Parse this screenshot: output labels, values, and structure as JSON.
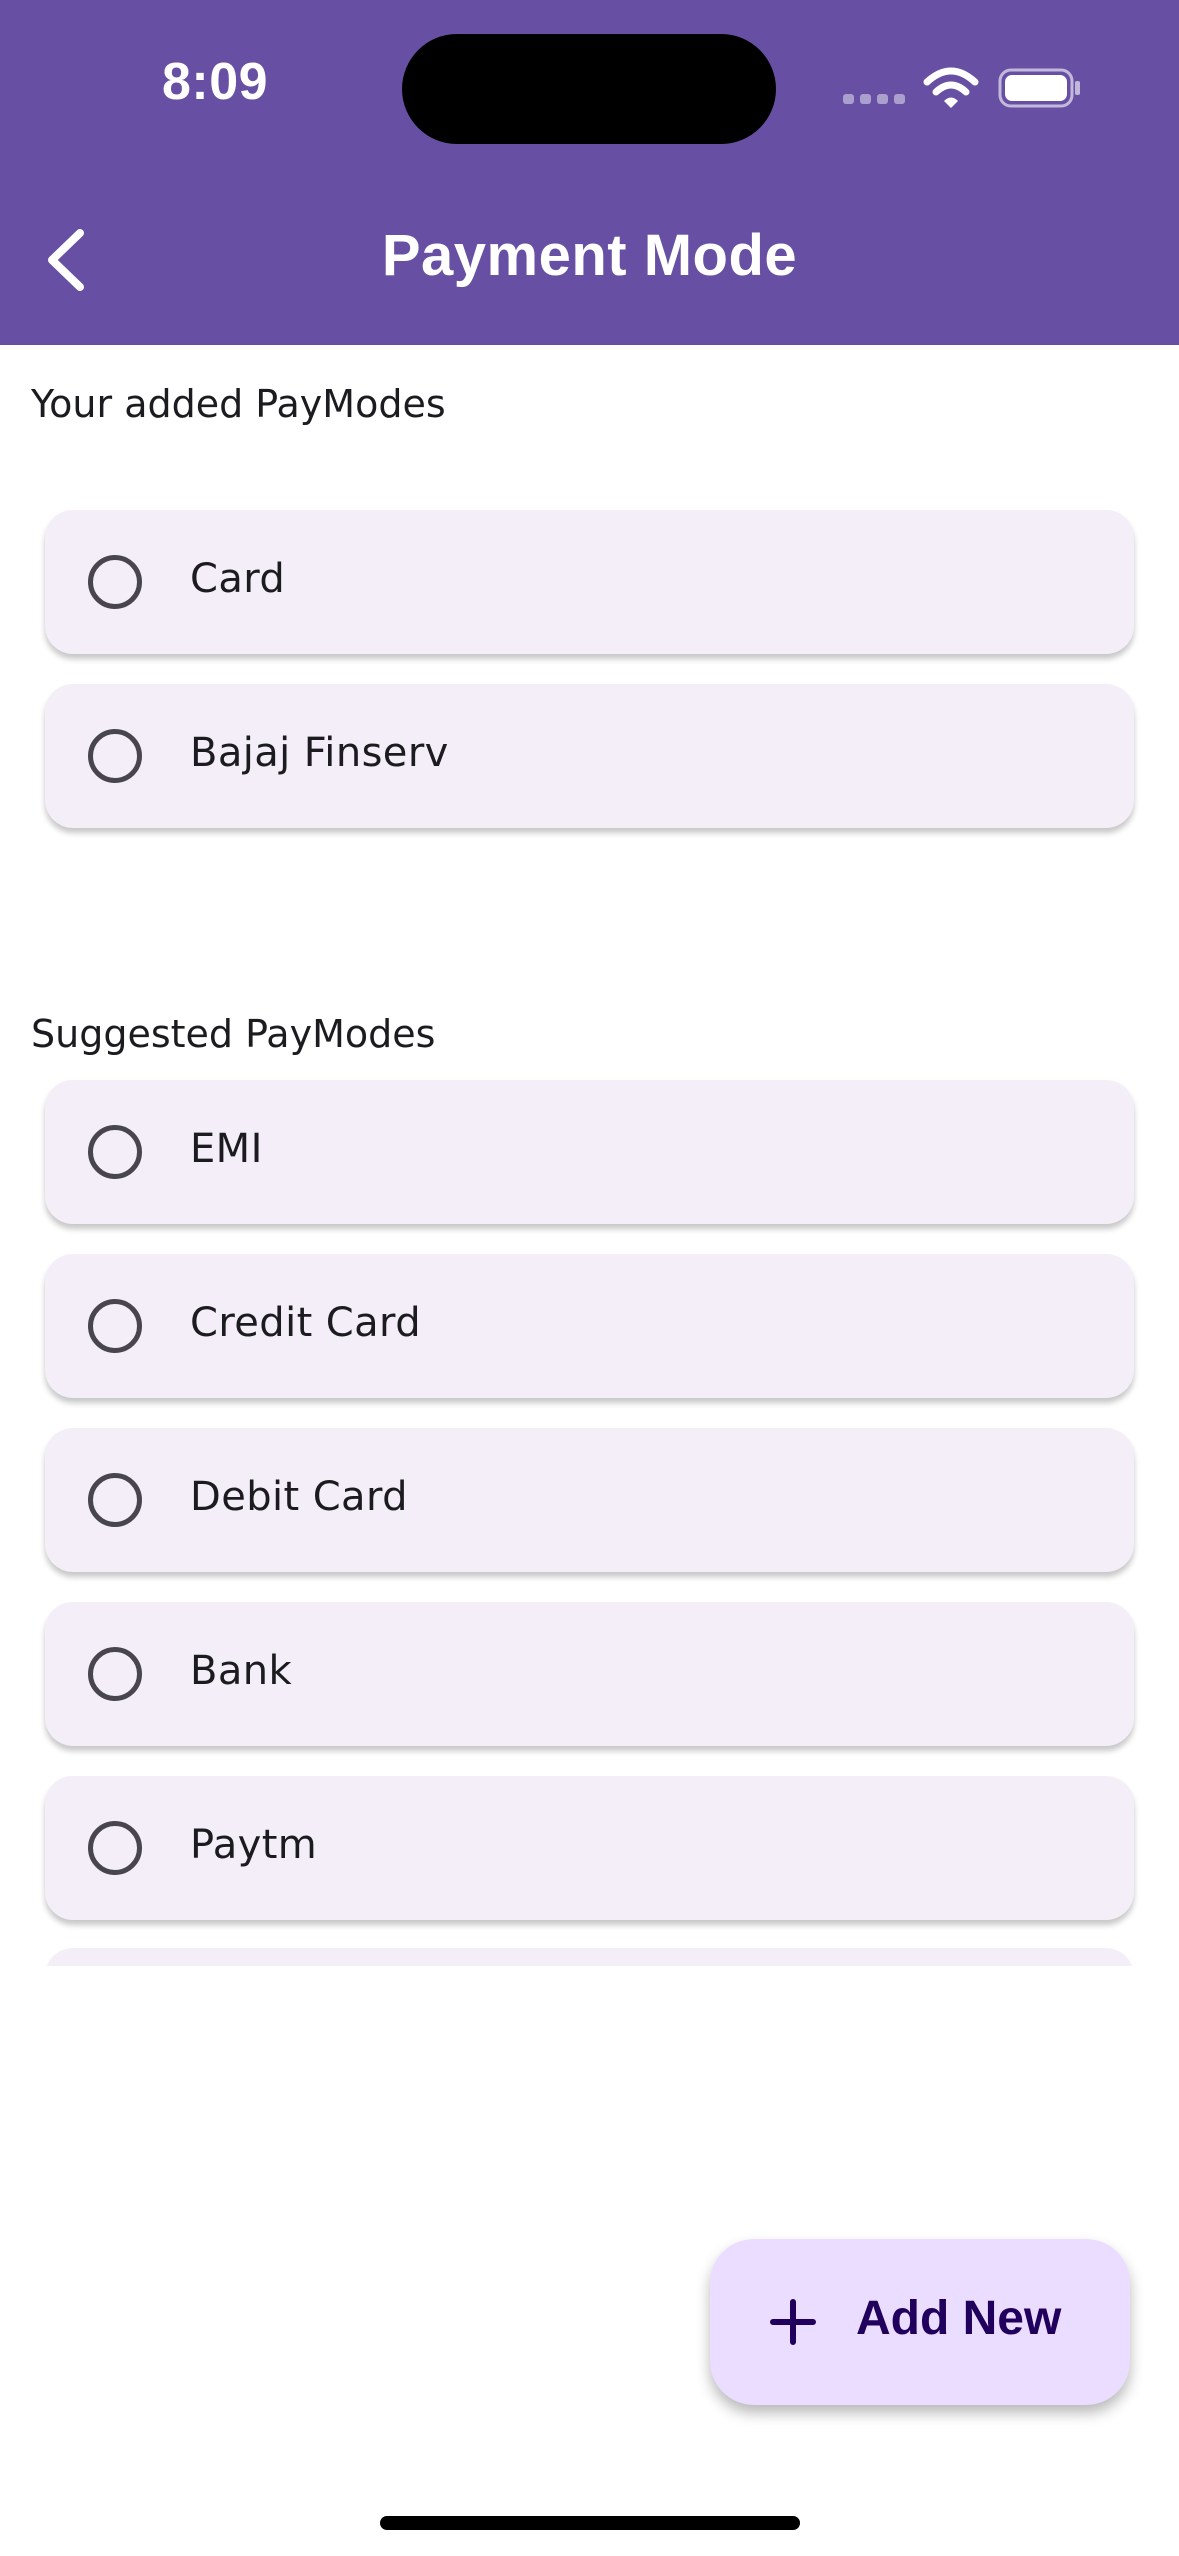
{
  "status_bar": {
    "time": "8:09"
  },
  "app_bar": {
    "title": "Payment Mode",
    "back_icon": "chevron-left-icon",
    "background": "#6750a4"
  },
  "added_section": {
    "heading": "Your added PayModes",
    "items": [
      {
        "label": "Card",
        "selected": false
      },
      {
        "label": "Bajaj Finserv",
        "selected": false
      }
    ]
  },
  "suggested_section": {
    "heading": "Suggested PayModes",
    "items": [
      {
        "label": "EMI",
        "selected": false
      },
      {
        "label": "Credit Card",
        "selected": false
      },
      {
        "label": "Debit Card",
        "selected": false
      },
      {
        "label": "Bank",
        "selected": false
      },
      {
        "label": "Paytm",
        "selected": false
      }
    ]
  },
  "fab": {
    "label": "Add New",
    "icon": "plus-icon",
    "background": "#eaddff",
    "text_color": "#21005d"
  },
  "colors": {
    "tile_background": "#f3eef7",
    "radio_border": "#49454f"
  }
}
